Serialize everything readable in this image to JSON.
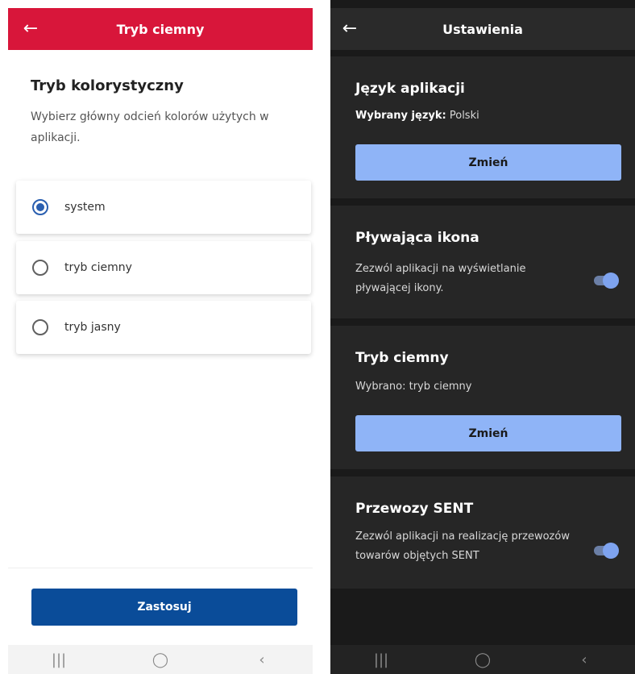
{
  "left": {
    "header": {
      "title": "Tryb ciemny",
      "back_icon": "arrow-left-icon"
    },
    "section": {
      "title": "Tryb kolorystyczny",
      "description": "Wybierz główny odcień kolorów użytych w aplikacji."
    },
    "options": [
      {
        "label": "system",
        "selected": true
      },
      {
        "label": "tryb ciemny",
        "selected": false
      },
      {
        "label": "tryb jasny",
        "selected": false
      }
    ],
    "apply_label": "Zastosuj",
    "navbar": {
      "recents": "|||",
      "home": "◯",
      "back": "‹"
    }
  },
  "right": {
    "header": {
      "title": "Ustawienia",
      "back_icon": "arrow-left-icon"
    },
    "language": {
      "title": "Język aplikacji",
      "selected_label": "Wybrany język:",
      "selected_value": "Polski",
      "button": "Zmień"
    },
    "floating_icon": {
      "title": "Pływająca ikona",
      "description": "Zezwól aplikacji na wyświetlanie pływającej ikony.",
      "enabled": true
    },
    "dark_mode": {
      "title": "Tryb ciemny",
      "selected_label": "Wybrano:",
      "selected_value": "tryb ciemny",
      "button": "Zmień"
    },
    "sent": {
      "title": "Przewozy SENT",
      "description": "Zezwól aplikacji na realizację przewozów towarów objętych SENT",
      "enabled": true
    },
    "navbar": {
      "recents": "|||",
      "home": "◯",
      "back": "‹"
    }
  },
  "colors": {
    "left_header": "#d8163a",
    "apply_button": "#0a4c99",
    "radio_selected": "#2a5fb0",
    "dark_background": "#1a1a1a",
    "dark_card": "#262626",
    "change_button": "#8fb4f7",
    "toggle_on": "#7ea3ef"
  }
}
